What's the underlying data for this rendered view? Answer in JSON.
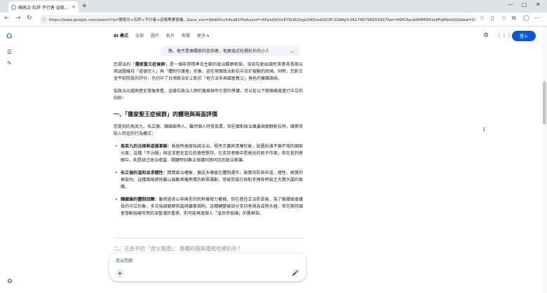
{
  "browser": {
    "tab_title": "陳佩文·石評 不行者·這條黑果會議...",
    "tab_close": "×",
    "new_tab": "+",
    "window": {
      "min": "—",
      "max": "▢",
      "close": "✕"
    },
    "url": "https://www.google.com/search?q=陳佩文+石評+不行者+這條黑果會議...&sca_esv=9ddb5cc54ca81f0e&sxsrf=AFpeQInVxEYSUK2logU2K5mdUO3P-G3Afg%3A1786798253937&ei=KWCAaub6MMSH1e8FgMbtsQQ&biw=1912&bih=914&uact=5&ac..."
  },
  "rail": {
    "logo": "G"
  },
  "nav": {
    "items": [
      "AI 模式",
      "全部",
      "圖片",
      "影片",
      "新聞",
      "更多 ▾"
    ]
  },
  "header": {
    "signin": "登入"
  },
  "bubble": {
    "text": "態，他不是個儒家的信仰者，他更接近吃裡扒外的小人",
    "chev": "︿"
  },
  "content": {
    "p1_lead": "您提出的「",
    "p1_bold": "儒家聖王症候群",
    "p1_rest": "」是一個非常精準且生動的政治觀察術語，深刻勾勒出國民黨菁英長期以來試圖維持「道德完人」與「體制守護者」形象，卻在現實政治對抗中流於被動的困境。同時，您對王金平前院長的評分，也切中了台灣政治史上對於「地方派系與國會教父」角色的複雜論辯。",
    "p2": "從政治光譜與歷史發展來看，這幾位政治人物的風格與所引發的爭議，可以從以下兩個維度進行中立的剖析：",
    "h1": "一、「儒家聖王症候群」的體現與兩面評價",
    "p3": "您提到的馬英九、朱立倫、韓國瑜等人，雖然個人特質各異，但在面對政治風暴與朝野對抗時，確實常陷入特定的行為模式：",
    "b1_title": "馬英九的法律與道德潔癖：",
    "b1_text": "執政時高度強調法治、程序正義與清廉形象，試圖扮演不偏不倚的國家元首。這種「不沾鍋」與追求歷史定位的德感堅持，在支持者眼中是高尚的君子作風；但在批判者眼中，則是缺乏政治擔當、關鍵時刻無法保護同黨同志的政治敗筆。",
    "b2_title": "朱立倫的溫和派求穩性：",
    "b2_text": "精算政治權衡，偏送多傳留在體制運作、政策攻防與中道，理性、務實的框架內。這種風格使他雖以鼓動具備熱情的群眾運動，常被質疑在與對手搏奔時缺乏大開大闔的氣魄。",
    "b3_title": "韓國瑜的體制回歸：",
    "b3_text": "雖然過去以非典型的民粹爆發力著稱，但在擔任立法院長後，為了維護國會議長的中立形象，多次強調朝野和諧與議事規則。這種轉變被部分支持者視為成熟大器，但在期待國會發動強硬攻勢的深藍選民看來，則可能再度掉入「溫良恭儉讓」的舊框架。",
    "h2": "二、王金平的「虎父報恩」：是權和衛與還是吃裡扒外？"
  },
  "ask": {
    "placeholder": "提出問題",
    "plus": "+",
    "mic": "🎤"
  },
  "colors": {
    "accent": "#0b57d0",
    "bubble": "#f0f4f9"
  }
}
